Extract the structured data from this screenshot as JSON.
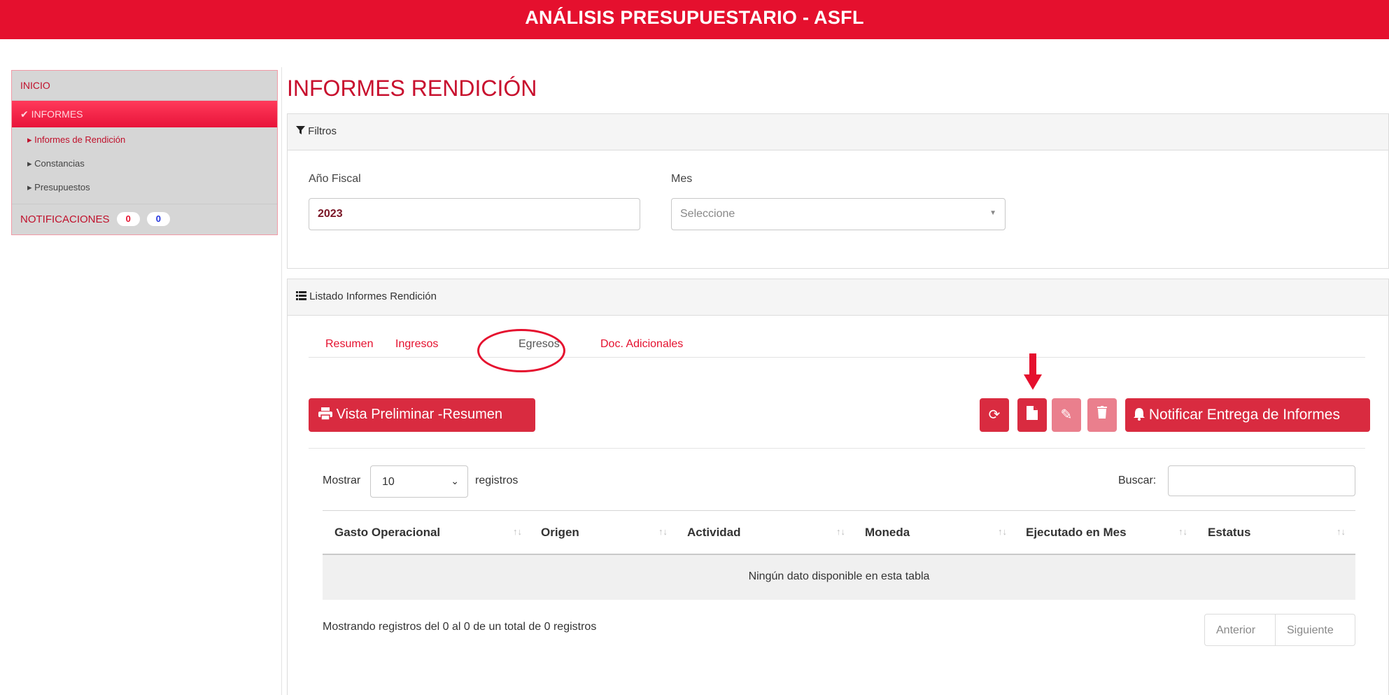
{
  "header": {
    "title": "ANÁLISIS PRESUPUESTARIO - ASFL"
  },
  "sidebar": {
    "inicio": "INICIO",
    "informes": "INFORMES",
    "sub_items": [
      "Informes de Rendición",
      "Constancias",
      "Presupuestos"
    ],
    "notificaciones": {
      "label": "NOTIFICACIONES",
      "count_red": "0",
      "count_blue": "0"
    }
  },
  "page": {
    "title": "INFORMES RENDICIÓN"
  },
  "filtros": {
    "heading": "Filtros",
    "anio_label": "Año Fiscal",
    "anio_value": "2023",
    "mes_label": "Mes",
    "mes_placeholder": "Seleccione"
  },
  "listado": {
    "heading": "Listado Informes Rendición",
    "tabs": [
      "Resumen",
      "Ingresos",
      "Egresos",
      "Doc. Adicionales"
    ],
    "active_tab": "Egresos",
    "preview_button": "Vista Preliminar -Resumen",
    "notify_button": "Notificar Entrega de Informes",
    "show_label": "Mostrar",
    "show_value": "10",
    "records_label": "registros",
    "search_label": "Buscar:",
    "columns": [
      "Gasto Operacional",
      "Origen",
      "Actividad",
      "Moneda",
      "Ejecutado en Mes",
      "Estatus"
    ],
    "empty_message": "Ningún dato disponible en esta tabla",
    "info": "Mostrando registros del 0 al 0 de un total de 0 registros",
    "prev": "Anterior",
    "next": "Siguiente"
  },
  "colors": {
    "brand": "#e5102e",
    "button": "#d92b40",
    "button_disabled": "#ea7f8d"
  }
}
